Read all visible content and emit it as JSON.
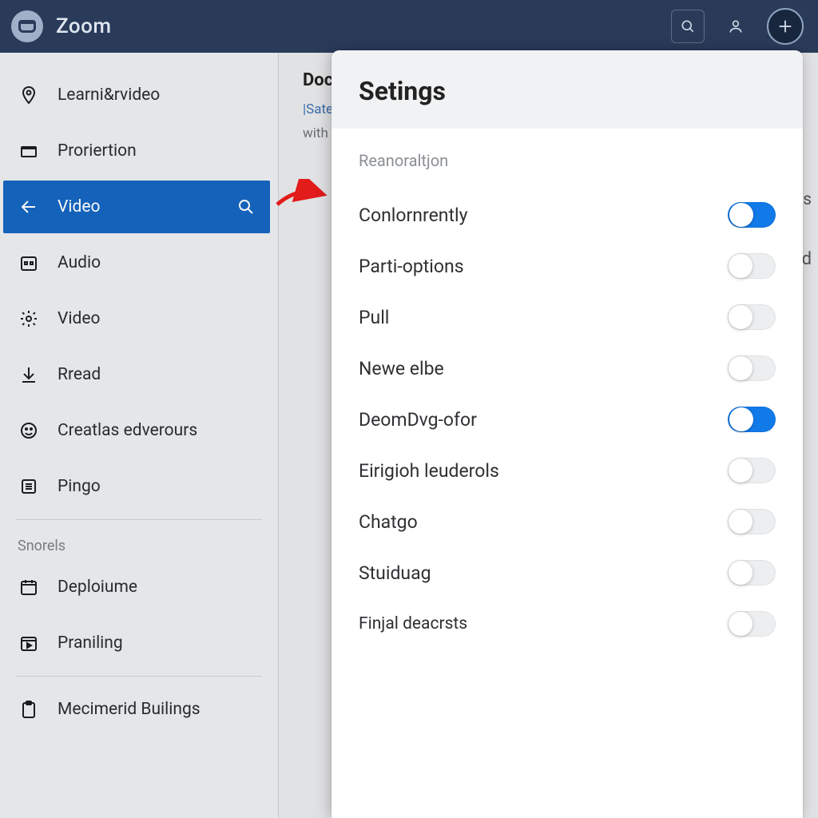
{
  "topbar": {
    "app_title": "Zoom"
  },
  "sidebar": {
    "items": [
      {
        "label": "Learni&rvideo",
        "icon": "pin"
      },
      {
        "label": "Proriertion",
        "icon": "folder"
      },
      {
        "label": "Video",
        "icon": "arrow-left",
        "active": true,
        "trailing": "search"
      },
      {
        "label": "Audio",
        "icon": "calendar-dots"
      },
      {
        "label": "Video",
        "icon": "gear"
      },
      {
        "label": "Rread",
        "icon": "download"
      },
      {
        "label": "Creatlas edverours",
        "icon": "face"
      },
      {
        "label": "Pingo",
        "icon": "list"
      }
    ],
    "section_label": "Snorels",
    "items2": [
      {
        "label": "Deploiume",
        "icon": "calendar"
      },
      {
        "label": "Praniling",
        "icon": "calendar-o"
      },
      {
        "label": "Mecimerid Builings",
        "icon": "clipboard"
      }
    ]
  },
  "content_back": {
    "doc": "Doc",
    "sat": "|Sater",
    "with": "with",
    "es": "es",
    "d": "d"
  },
  "settings": {
    "title": "Setings",
    "section": "Reanoraltjon",
    "rows": [
      {
        "label": "Conlornrently",
        "on": true
      },
      {
        "label": "Parti-options",
        "on": false
      },
      {
        "label": "Pull",
        "on": false
      },
      {
        "label": "Newe elbe",
        "on": false
      },
      {
        "label": "DeomDvg-ofor",
        "on": true
      },
      {
        "label": "Eirigioh leuderols",
        "on": false
      },
      {
        "label": "Chatgo",
        "on": false
      },
      {
        "label": "Stuiduag",
        "on": false
      },
      {
        "label": "Finjal deacrsts",
        "on": false,
        "small": true
      }
    ]
  }
}
